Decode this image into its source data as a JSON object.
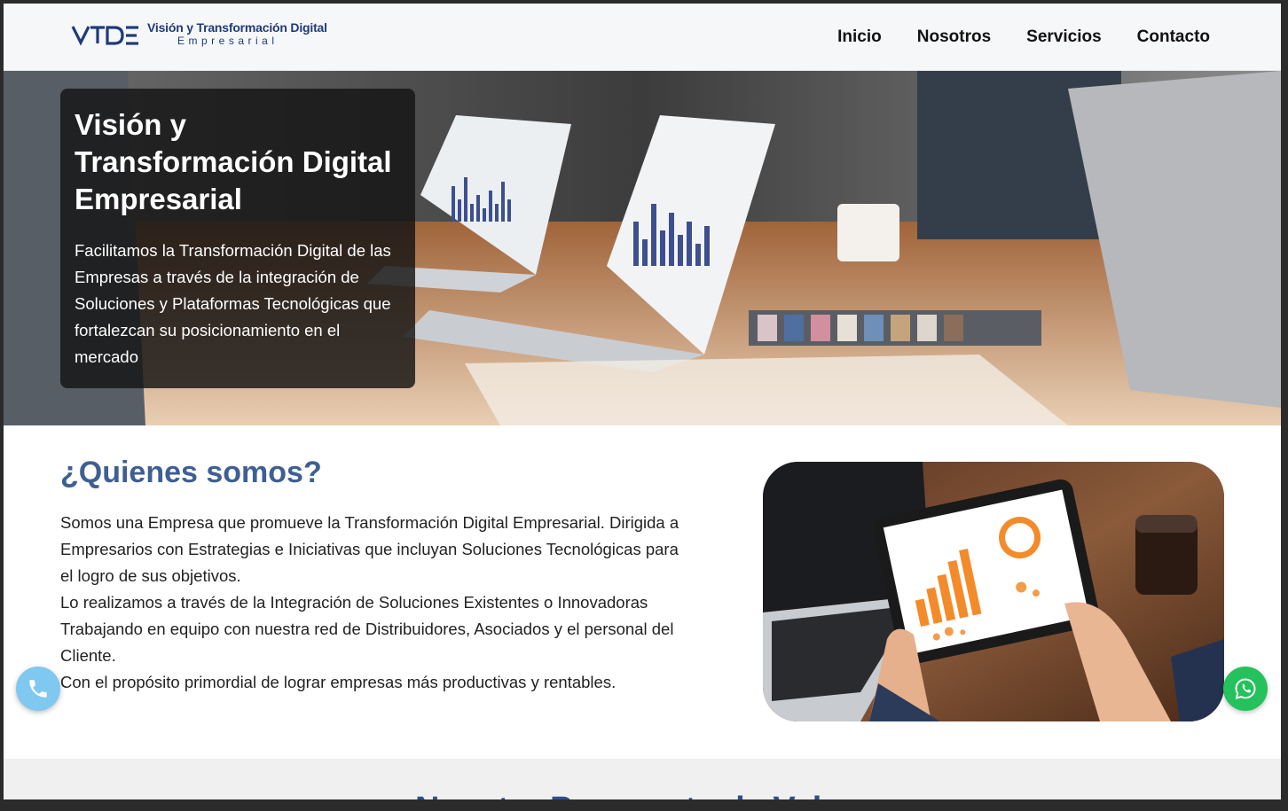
{
  "header": {
    "logo_mark": "VTDE",
    "logo_line1": "Visión y Transformación Digital",
    "logo_line2": "Empresarial",
    "nav": [
      "Inicio",
      "Nosotros",
      "Servicios",
      "Contacto"
    ]
  },
  "hero": {
    "title": "Visión y Transformación Digital Empresarial",
    "text": "Facilitamos la Transformación Digital de las Empresas a través de la integración de Soluciones y Plataformas Tecnológicas que fortalezcan su posicionamiento en el mercado"
  },
  "about": {
    "title": "¿Quienes somos?",
    "paragraphs": [
      "Somos una Empresa que promueve la Transformación Digital Empresarial. Dirigida a Empresarios con Estrategias e Iniciativas que incluyan Soluciones Tecnológicas para el logro de sus objetivos.",
      "Lo realizamos a través de la Integración de Soluciones Existentes o Innovadoras Trabajando en equipo con nuestra red de Distribuidores, Asociados y el personal del Cliente.",
      "Con el propósito primordial de lograr empresas más productivas y rentables."
    ]
  },
  "floating": {
    "call_icon": "phone-icon",
    "whatsapp_icon": "whatsapp-icon"
  },
  "next_section": {
    "title": "Nuestra Propuesta de Valor"
  },
  "colors": {
    "brand_blue": "#1f3b78",
    "heading_blue": "#3f5f92",
    "whatsapp_green": "#25c15c",
    "call_blue": "#7fc8ef"
  }
}
